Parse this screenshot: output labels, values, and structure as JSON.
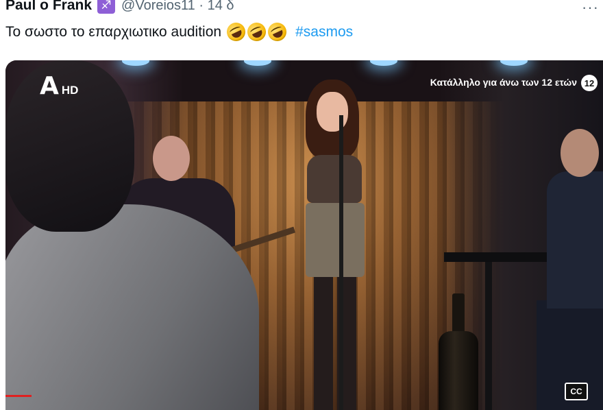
{
  "tweet": {
    "display_name": "Paul o Frank",
    "zodiac_glyph": "♐",
    "handle_time": "@Voreios11 · 14 δ",
    "more_glyph": "···",
    "text": "Το σωστο το επαρχιωτικο audition",
    "hashtag": "#sasmos",
    "emoji_count": 3,
    "emoji_name": "rolling-on-the-floor-laughing-emoji"
  },
  "video": {
    "channel_letter": "A",
    "channel_hd": "HD",
    "rating_text": "Κατάλληλο για άνω των 12 ετών",
    "rating_badge": "12",
    "cc_label": "CC",
    "progress": 0.04
  },
  "colors": {
    "hashtag": "#1d9bf0",
    "zodiac_badge": "#8e5fd6",
    "progress": "#e02020"
  }
}
